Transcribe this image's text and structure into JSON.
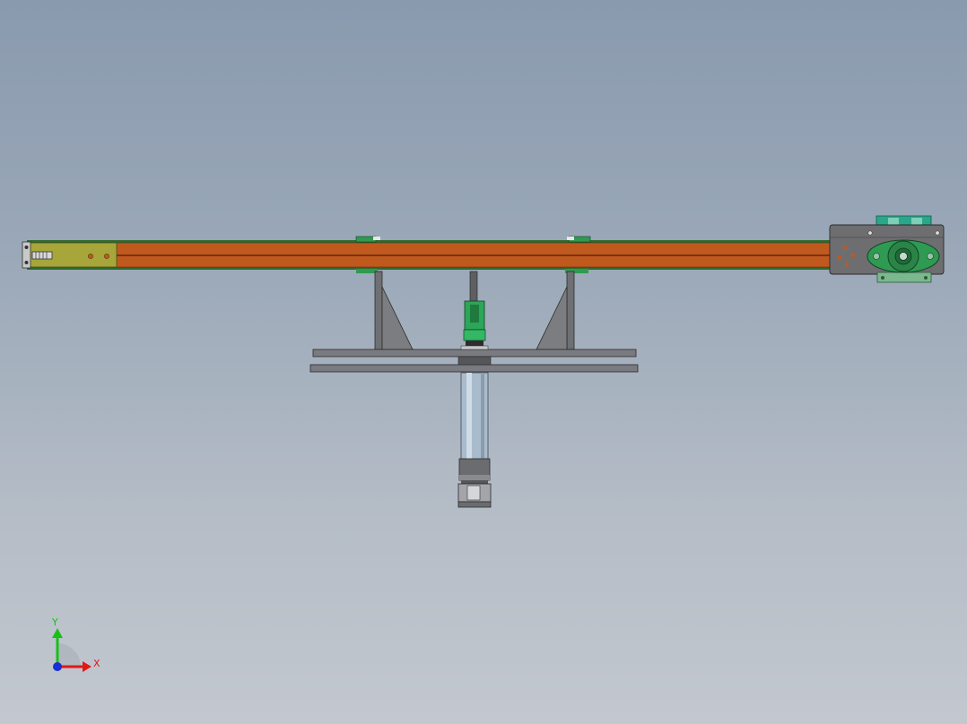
{
  "viewport": {
    "background_top": "#8a9aae",
    "background_bottom": "#c3c8cf"
  },
  "triad": {
    "x_label": "X",
    "y_label": "Y",
    "x_color": "#e01818",
    "y_color": "#18c018",
    "z_color": "#1830d0"
  },
  "colors": {
    "belt_orange": "#c0591e",
    "belt_dark": "#7a3212",
    "frame_green": "#2e6b2e",
    "tail_plate": "#a6a63a",
    "drive_housing": "#6e6e70",
    "bearing_green": "#2f9a52",
    "motor_teal": "#2aa78a",
    "steel_gray": "#6f7074",
    "cylinder_glass": "#a9bccd"
  }
}
